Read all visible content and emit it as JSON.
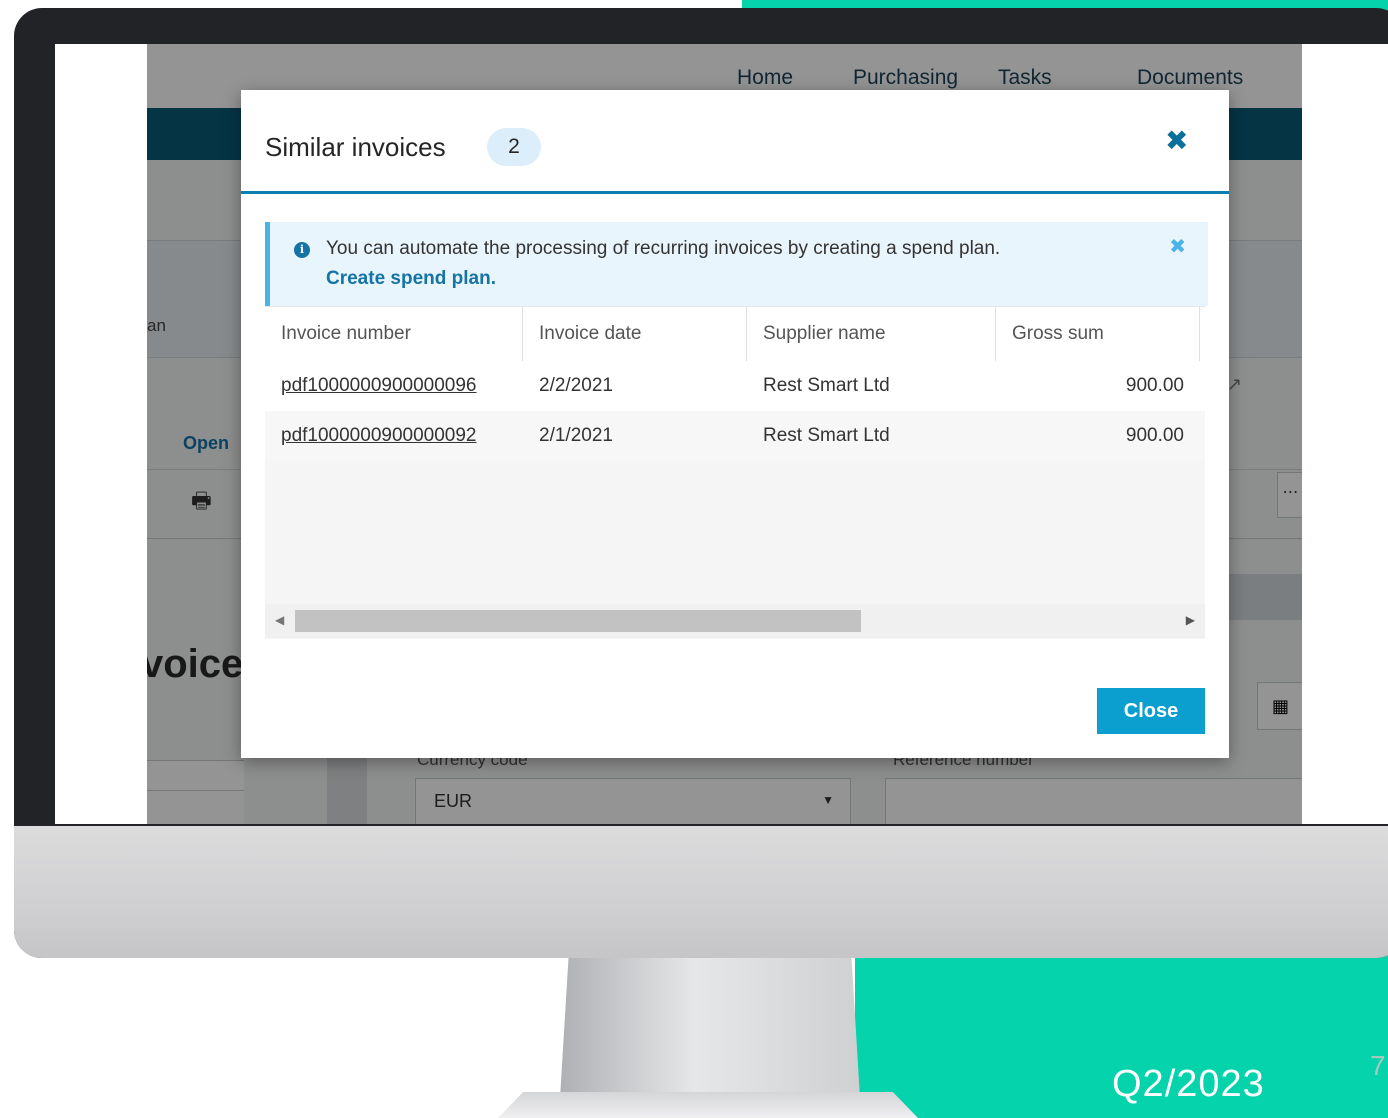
{
  "slide": {
    "label": "Q2/2023",
    "page_number": "7",
    "accent_color": "#05d3ab"
  },
  "app": {
    "nav": [
      {
        "label": "Home"
      },
      {
        "label": "Purchasing"
      },
      {
        "label": "Tasks"
      },
      {
        "label": "Documents"
      }
    ],
    "background_text": {
      "tab_fragment": "an",
      "open_label": "Open",
      "page_heading_fragment": "voice",
      "currency_label": "Currency code",
      "reference_label": "Reference number",
      "currency_value": "EUR"
    }
  },
  "modal": {
    "title": "Similar invoices",
    "count": "2",
    "alert": {
      "text": "You can automate the processing of recurring invoices by creating a spend plan.",
      "link": "Create spend plan."
    },
    "table": {
      "columns": [
        "Invoice number",
        "Invoice date",
        "Supplier name",
        "Gross sum"
      ],
      "rows": [
        {
          "invoice_number": "pdf1000000900000096",
          "invoice_date": "2/2/2021",
          "supplier": "Rest Smart Ltd",
          "gross_sum": "900.00"
        },
        {
          "invoice_number": "pdf1000000900000092",
          "invoice_date": "2/1/2021",
          "supplier": "Rest Smart Ltd",
          "gross_sum": "900.00"
        }
      ]
    },
    "close_button": "Close"
  }
}
